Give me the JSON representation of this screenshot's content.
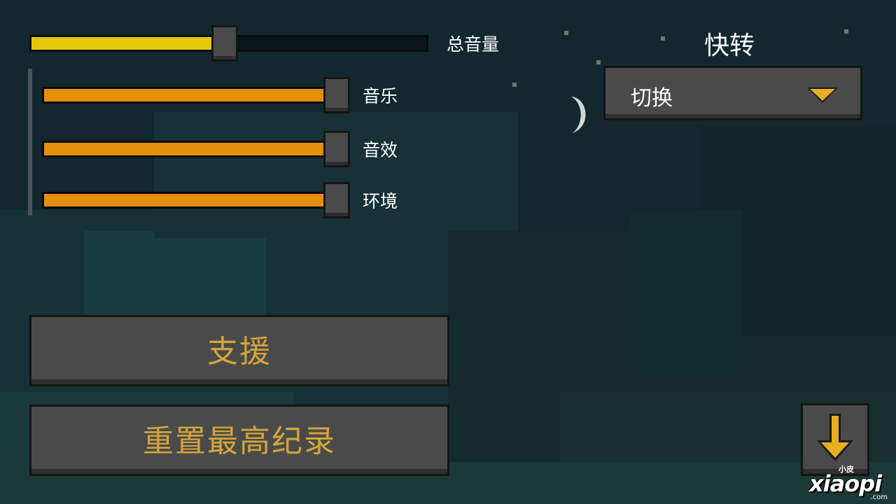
{
  "volume": {
    "master": {
      "label": "总音量",
      "level": 0.49
    },
    "music": {
      "label": "音乐",
      "level": 1.0
    },
    "sfx": {
      "label": "音效",
      "level": 1.0
    },
    "ambient": {
      "label": "环境",
      "level": 1.0
    }
  },
  "quick_turn": {
    "title": "快转",
    "selected": "切换"
  },
  "buttons": {
    "support": "支援",
    "reset_highscore": "重置最高纪录"
  },
  "watermark": {
    "cn": "小皮",
    "en": "xiaopi",
    "domain": ".com"
  },
  "colors": {
    "master_fill": "#e6c80a",
    "sub_fill": "#e4900c",
    "button_text": "#d4a53a",
    "accent_arrow": "#e8b020"
  },
  "icons": {
    "dropdown": "triangle-down-icon",
    "scroll_down": "arrow-down-icon",
    "moon": "crescent-moon-icon"
  }
}
